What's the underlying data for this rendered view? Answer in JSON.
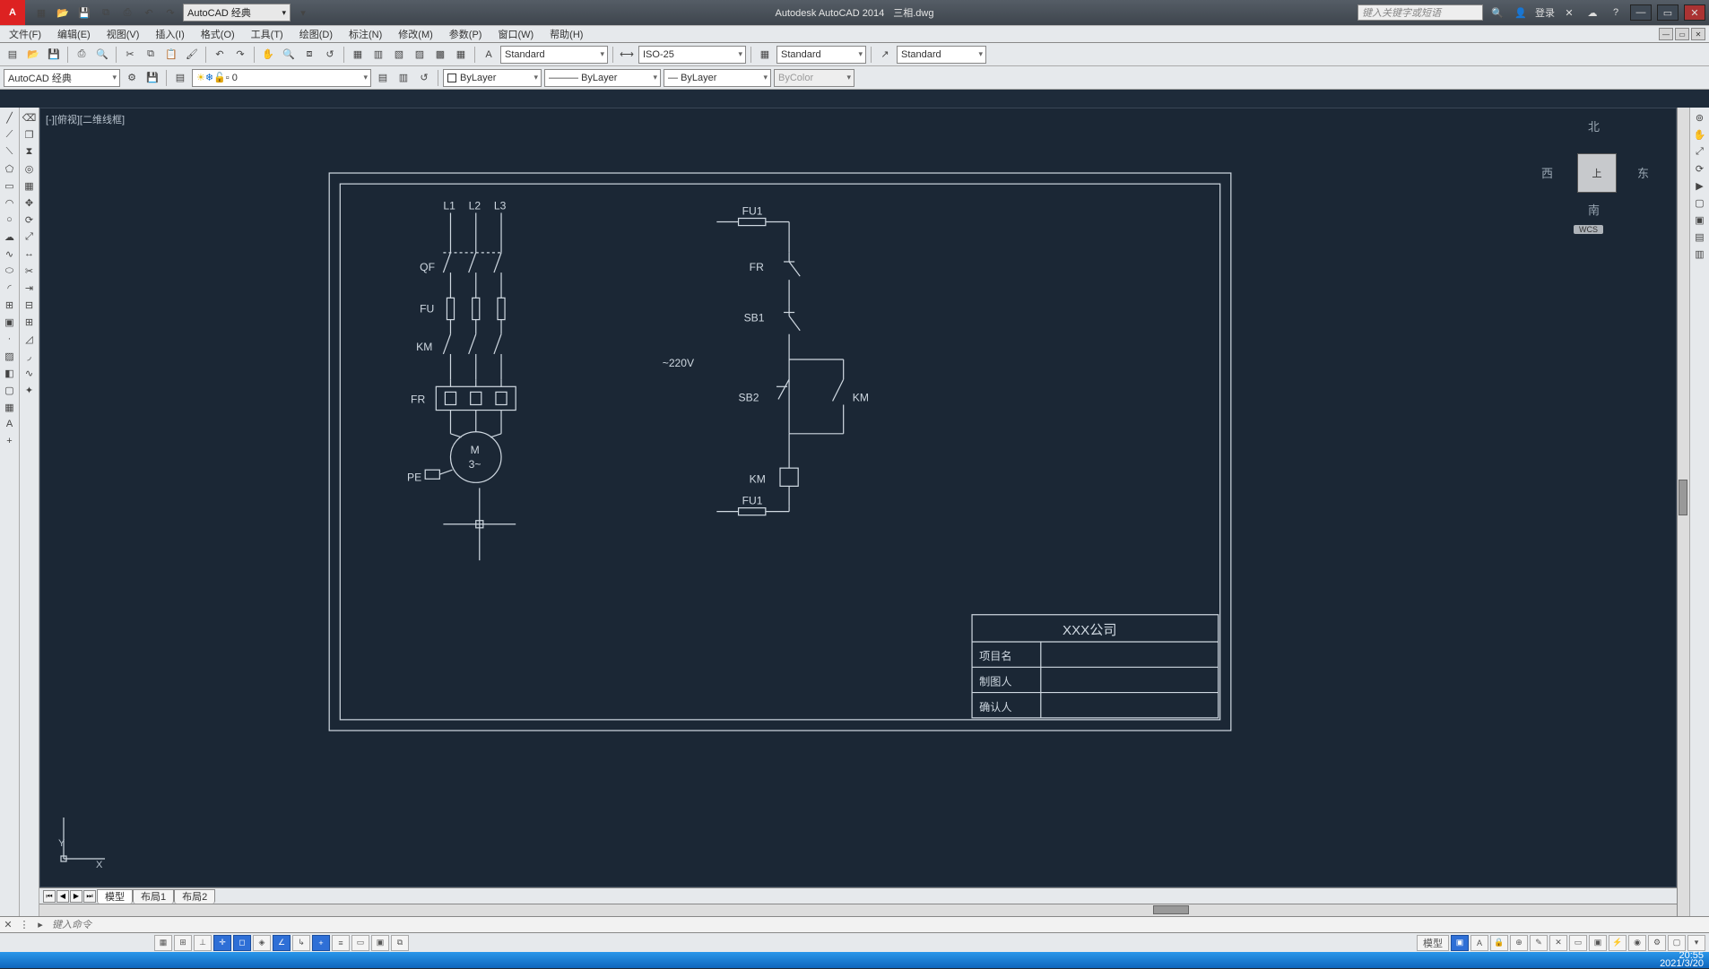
{
  "title_app": "Autodesk AutoCAD 2014",
  "title_doc": "三相.dwg",
  "workspace_dd": "AutoCAD 经典",
  "search_placeholder": "键入关键字或短语",
  "login_label": "登录",
  "menus": [
    "文件(F)",
    "编辑(E)",
    "视图(V)",
    "插入(I)",
    "格式(O)",
    "工具(T)",
    "绘图(D)",
    "标注(N)",
    "修改(M)",
    "参数(P)",
    "窗口(W)",
    "帮助(H)"
  ],
  "row1": {
    "dimstyle": "ISO-25",
    "textstyle": "Standard",
    "tablestyle": "Standard"
  },
  "row2": {
    "workspace": "AutoCAD 经典",
    "layer": "0",
    "linetype": "ByLayer",
    "lineweight": "ByLayer",
    "plotstyle": "ByColor",
    "color_label": "ByLayer"
  },
  "viewport_label": "[-][俯视][二维线框]",
  "viewcube": {
    "n": "北",
    "s": "南",
    "e": "东",
    "w": "西",
    "top": "上",
    "wcs": "WCS"
  },
  "ucs": {
    "x": "X",
    "y": "Y"
  },
  "tabs": {
    "model": "模型",
    "layout1": "布局1",
    "layout2": "布局2"
  },
  "cmd_placeholder": "键入命令",
  "status": {
    "model_btn": "模型"
  },
  "clock": {
    "time": "20:55",
    "date": "2021/3/20"
  },
  "drawing": {
    "L1": "L1",
    "L2": "L2",
    "L3": "L3",
    "QF": "QF",
    "FU": "FU",
    "KM": "KM",
    "FR": "FR",
    "PE": "PE",
    "M": "M",
    "M3": "3~",
    "FU1": "FU1",
    "FR_r": "FR",
    "SB1": "SB1",
    "SB2": "SB2",
    "KM_coil": "KM",
    "KM_aux": "KM",
    "V220": "~220V",
    "tb_company": "XXX公司",
    "tb_proj": "项目名",
    "tb_draw": "制图人",
    "tb_conf": "确认人"
  }
}
